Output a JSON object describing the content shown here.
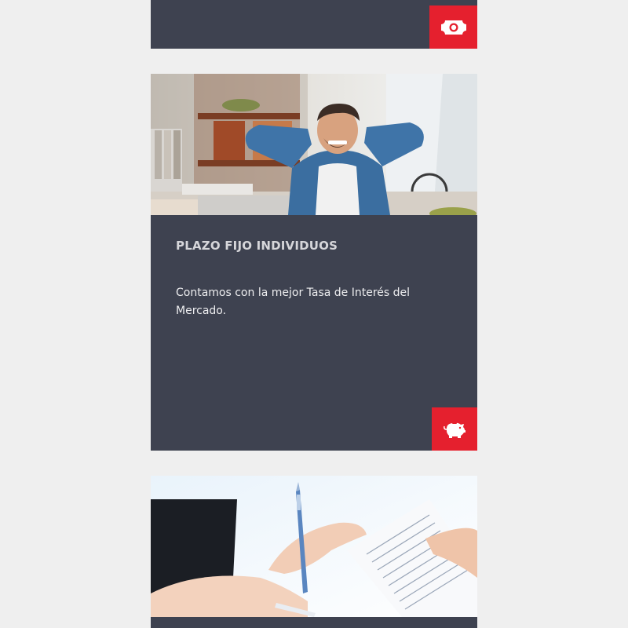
{
  "cards": [
    {
      "icon": "banknote-icon"
    },
    {
      "title": "PLAZO FIJO INDIVIDUOS",
      "description": "Contamos con la mejor Tasa de Interés del Mercado.",
      "image": "man-relaxing-at-desk-photo",
      "icon": "piggy-bank-icon"
    },
    {
      "image": "hands-with-pen-and-document-photo"
    }
  ],
  "colors": {
    "background": "#efefef",
    "card": "#3e4250",
    "accent": "#e5202e",
    "title": "#d6d6da",
    "text": "#eeeef0"
  }
}
